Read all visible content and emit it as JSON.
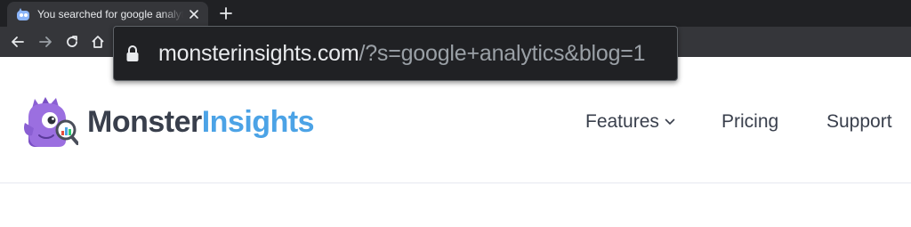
{
  "browser": {
    "tab": {
      "title": "You searched for google analytics",
      "favicon": "monsterinsights-favicon"
    },
    "icons": {
      "close": "close-icon",
      "new_tab": "plus-icon",
      "back": "arrow-left-icon",
      "forward": "arrow-right-icon",
      "reload": "reload-icon",
      "home": "home-icon",
      "lock": "lock-icon"
    },
    "url": {
      "domain": "monsterinsights.com",
      "path": "/?s=google+analytics&blog=1"
    },
    "colors": {
      "tabstrip": "#202124",
      "toolbar": "#35363a",
      "omnibox": "#202124",
      "url_text": "#e8eaed",
      "url_dim": "#9aa0a6"
    }
  },
  "site": {
    "logo": {
      "part1": "Monster",
      "part2": "Insights",
      "mascot": "monster-mascot-icon"
    },
    "nav": {
      "features": "Features",
      "pricing": "Pricing",
      "support": "Support"
    },
    "colors": {
      "brand_dark": "#393f4c",
      "brand_blue": "#4ca3e6",
      "mascot_purple": "#8a5fd3"
    }
  }
}
